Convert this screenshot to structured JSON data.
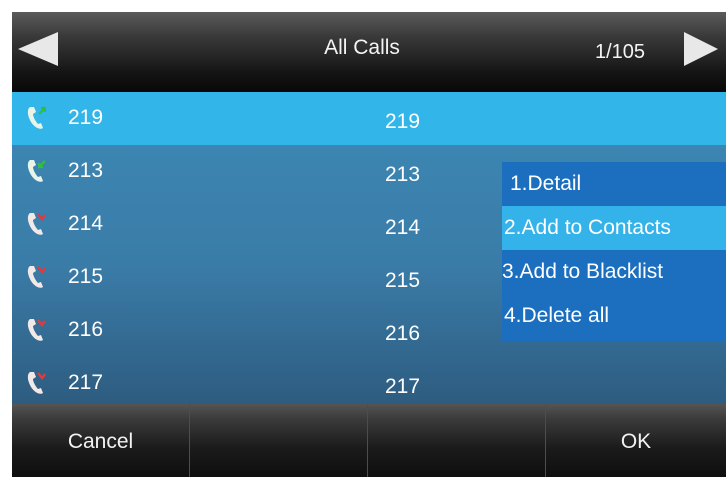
{
  "header": {
    "title": "All Calls",
    "page_indicator": "1/105"
  },
  "calls": [
    {
      "name": "219",
      "number": "219",
      "icon": "outgoing-call-icon",
      "icon_color": "#2fbf3f",
      "selected": true
    },
    {
      "name": "213",
      "number": "213",
      "icon": "received-call-icon",
      "icon_color": "#2fbf3f",
      "selected": false
    },
    {
      "name": "214",
      "number": "214",
      "icon": "missed-call-icon",
      "icon_color": "#e23a3a",
      "selected": false
    },
    {
      "name": "215",
      "number": "215",
      "icon": "missed-call-icon",
      "icon_color": "#e23a3a",
      "selected": false
    },
    {
      "name": "216",
      "number": "216",
      "icon": "missed-call-icon",
      "icon_color": "#e23a3a",
      "selected": false
    },
    {
      "name": "217",
      "number": "217",
      "icon": "missed-call-icon",
      "icon_color": "#e23a3a",
      "selected": false
    }
  ],
  "popup_menu": {
    "items": [
      {
        "label": "1.Detail",
        "highlighted": false
      },
      {
        "label": "2.Add to Contacts",
        "highlighted": true
      },
      {
        "label": "3.Add to Blacklist",
        "highlighted": false
      },
      {
        "label": "4.Delete all",
        "highlighted": false
      }
    ]
  },
  "softkeys": [
    "Cancel",
    "",
    "",
    "OK"
  ],
  "colors": {
    "list_background": "#3a7ca8",
    "selected_row": "#32b6e9",
    "popup_background": "#1c6fbf",
    "popup_highlight": "#33b3ea"
  }
}
